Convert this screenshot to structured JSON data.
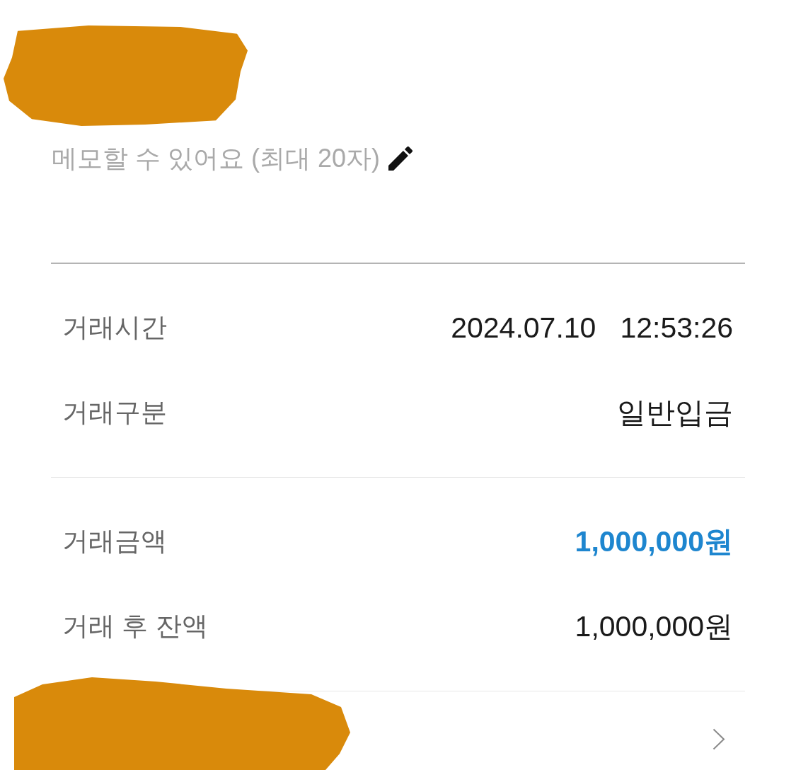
{
  "memo": {
    "placeholder": "메모할 수 있어요 (최대 20자)"
  },
  "detail_groups": [
    {
      "rows": [
        {
          "label": "거래시간",
          "values": [
            "2024.07.10",
            "12:53:26"
          ],
          "emphasized": false
        },
        {
          "label": "거래구분",
          "values": [
            "일반입금"
          ],
          "emphasized": false
        }
      ]
    },
    {
      "rows": [
        {
          "label": "거래금액",
          "values": [
            "1,000,000원"
          ],
          "emphasized": true
        },
        {
          "label": "거래 후 잔액",
          "values": [
            "1,000,000원"
          ],
          "emphasized": false
        }
      ]
    }
  ]
}
